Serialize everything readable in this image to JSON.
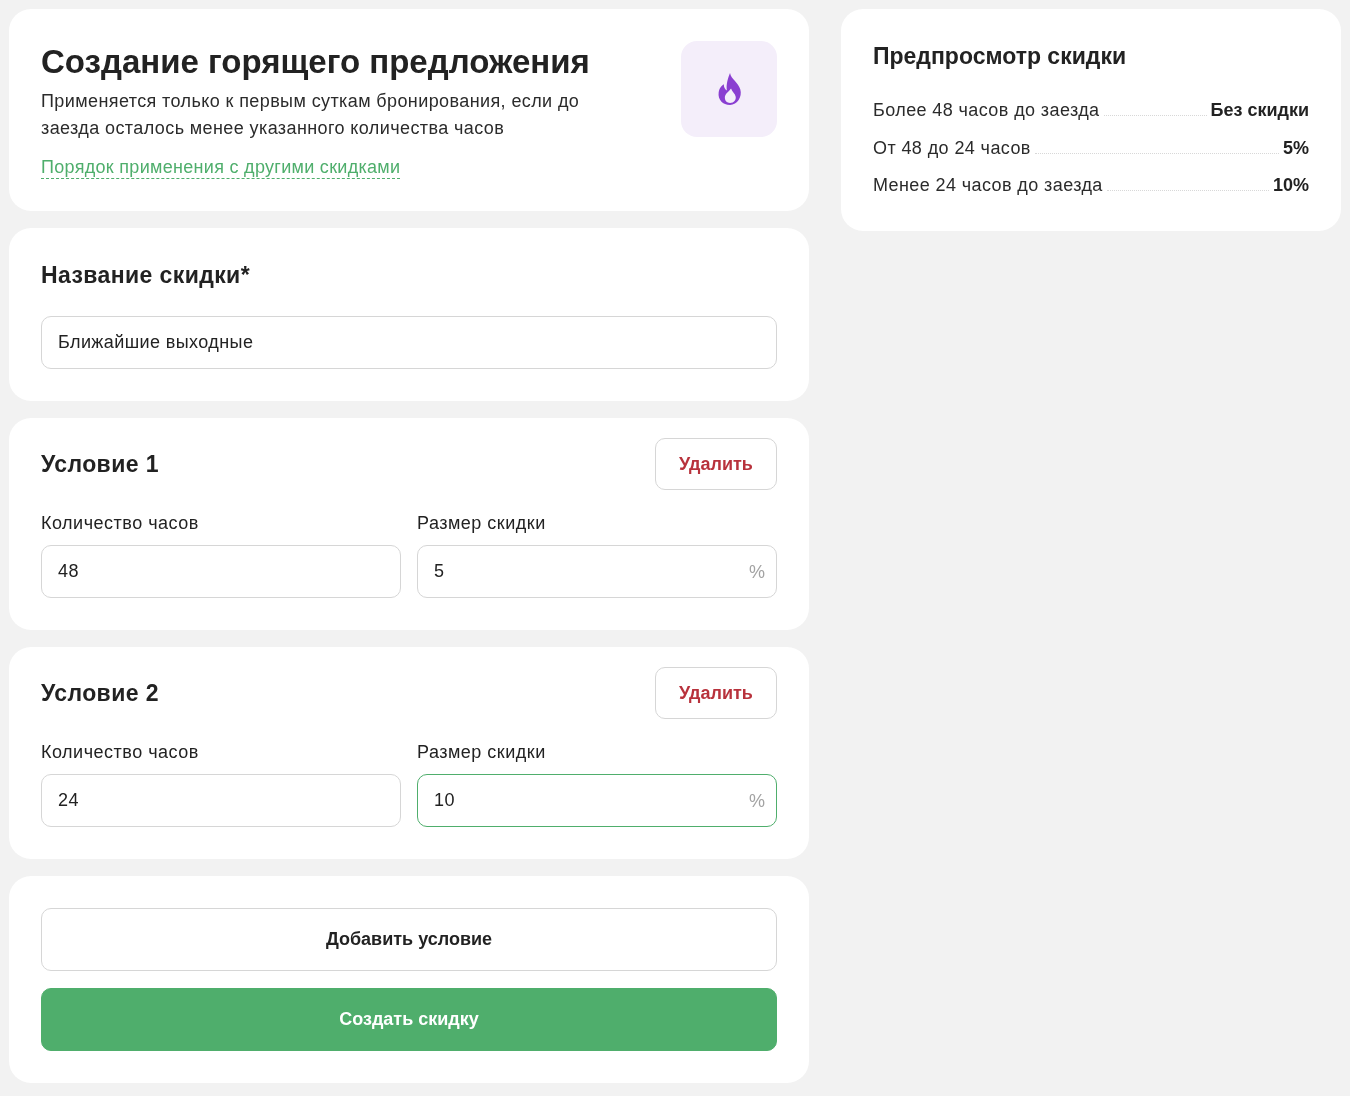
{
  "header": {
    "title": "Создание горящего предложения",
    "description": "Применяется только к первым суткам бронирования, если до заезда осталось менее указанного количества часов",
    "link": "Порядок применения с другими скидками"
  },
  "name_section": {
    "label": "Название скидки*",
    "value": "Ближайшие выходные",
    "focused": false
  },
  "conditions": [
    {
      "title": "Условие 1",
      "delete_button": "Удалить",
      "hours": {
        "label": "Количество часов",
        "value": "48",
        "focused": false
      },
      "discount": {
        "label": "Размер скидки",
        "value": "5",
        "suffix": "%",
        "focused": false
      }
    },
    {
      "title": "Условие 2",
      "delete_button": "Удалить",
      "hours": {
        "label": "Количество часов",
        "value": "24",
        "focused": false
      },
      "discount": {
        "label": "Размер скидки",
        "value": "10",
        "suffix": "%",
        "focused": true
      }
    }
  ],
  "actions": {
    "add_button": "Добавить условие",
    "submit_button": "Создать скидку"
  },
  "preview": {
    "title": "Предпросмотр скидки",
    "rows": [
      {
        "label": "Более 48 часов до заезда",
        "value": "Без скидки"
      },
      {
        "label": "От 48 до 24 часов",
        "value": "5%"
      },
      {
        "label": "Менее 24 часов до заезда",
        "value": "10%"
      }
    ]
  }
}
